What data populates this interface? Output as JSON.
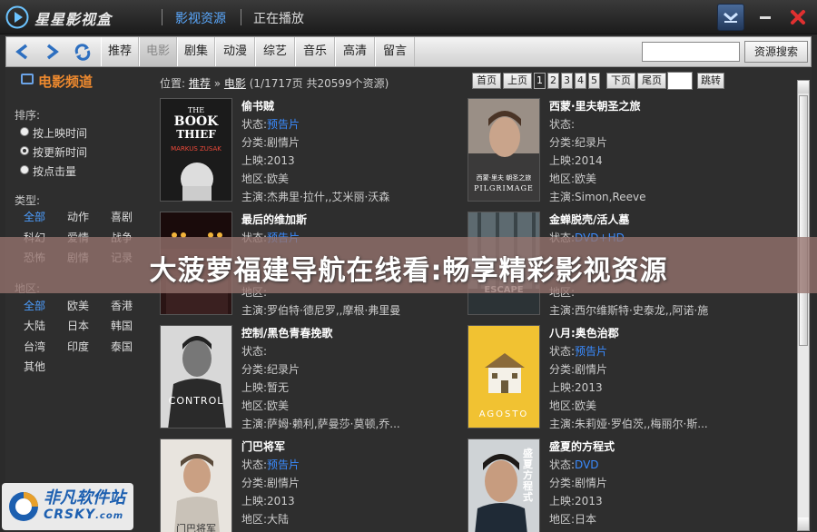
{
  "app": {
    "title": "星星影视盒"
  },
  "top_tabs": [
    {
      "label": "影视资源",
      "active": true
    },
    {
      "label": "正在播放",
      "active": false
    }
  ],
  "nav": {
    "tabs": [
      {
        "label": "推荐",
        "active": false
      },
      {
        "label": "电影",
        "active": true
      },
      {
        "label": "剧集",
        "active": false
      },
      {
        "label": "动漫",
        "active": false
      },
      {
        "label": "综艺",
        "active": false
      },
      {
        "label": "音乐",
        "active": false
      },
      {
        "label": "高清",
        "active": false
      },
      {
        "label": "留言",
        "active": false
      }
    ],
    "search_value": "",
    "search_button": "资源搜索"
  },
  "sidebar": {
    "channel_title": "电影频道",
    "sort_heading": "排序:",
    "sort_options": [
      {
        "label": "按上映时间",
        "selected": false
      },
      {
        "label": "按更新时间",
        "selected": true
      },
      {
        "label": "按点击量",
        "selected": false
      }
    ],
    "type_heading": "类型:",
    "types": [
      "全部",
      "动作",
      "喜剧",
      "科幻",
      "爱情",
      "战争",
      "恐怖",
      "剧情",
      "记录"
    ],
    "region_heading": "地区:",
    "regions": [
      "全部",
      "欧美",
      "香港",
      "大陆",
      "日本",
      "韩国",
      "台湾",
      "印度",
      "泰国",
      "其他"
    ]
  },
  "breadcrumb": {
    "prefix": "位置:",
    "home": "推荐",
    "sep": "»",
    "current": "电影",
    "info": "(1/1717页 共20599个资源)"
  },
  "pager": {
    "first": "首页",
    "prev": "上页",
    "pages": [
      "1",
      "2",
      "3",
      "4",
      "5"
    ],
    "current": "1",
    "next": "下页",
    "last": "尾页",
    "jump": "跳转"
  },
  "field_labels": {
    "status": "状态:",
    "category": "分类:",
    "release": "上映:",
    "region": "地区:",
    "cast": "主演:"
  },
  "movies": [
    {
      "title": "偷书贼",
      "status": "预告片",
      "category": "剧情片",
      "release": "2013",
      "region": "欧美",
      "cast": "杰弗里·拉什,,艾米丽·沃森",
      "poster_lines": [
        "THE",
        "BOOK",
        "THIEF",
        "MARKUS ZUSAK"
      ]
    },
    {
      "title": "西蒙·里夫朝圣之旅",
      "status": "",
      "category": "纪录片",
      "release": "2014",
      "region": "欧美",
      "cast": "Simon,Reeve",
      "poster_lines": [
        "西蒙·里夫 朝圣之旅",
        "PILGRIMAGE"
      ]
    },
    {
      "title": "最后的维加斯",
      "status": "预告片",
      "category": "",
      "release": "",
      "region": "",
      "cast": "罗伯特·德尼罗,,摩根·弗里曼",
      "poster_lines": []
    },
    {
      "title": "金蝉脱壳/活人墓",
      "status": "DVD+HD",
      "category": "",
      "release": "",
      "region": "",
      "cast": "西尔维斯特·史泰龙,,阿诺·施",
      "poster_lines": [
        "ESCAPE"
      ]
    },
    {
      "title": "控制/黑色青春挽歌",
      "status": "",
      "category": "纪录片",
      "release": "暂无",
      "region": "欧美",
      "cast": "萨姆·赖利,萨曼莎·莫顿,乔...",
      "poster_lines": [
        "CONTROL"
      ]
    },
    {
      "title": "八月:奥色治郡",
      "status": "预告片",
      "category": "剧情片",
      "release": "2013",
      "region": "欧美",
      "cast": "朱莉娅·罗伯茨,,梅丽尔·斯...",
      "poster_lines": [
        "AGOSTO"
      ]
    },
    {
      "title": "门巴将军",
      "status": "预告片",
      "category": "剧情片",
      "release": "2013",
      "region": "大陆",
      "cast": "",
      "poster_lines": [
        "门巴将军"
      ]
    },
    {
      "title": "盛夏的方程式",
      "status": "DVD",
      "category": "剧情片",
      "release": "2013",
      "region": "日本",
      "cast": "",
      "poster_lines": [
        "盛夏方程式"
      ]
    }
  ],
  "banner": {
    "text": "大菠萝福建导航在线看:畅享精彩影视资源"
  },
  "watermark": {
    "name": "非凡软件站",
    "url": "CRSKY",
    "domain": ".com"
  },
  "colors": {
    "accent_blue": "#3a8bff",
    "channel_orange": "#ef8a2e",
    "close_red": "#e03030"
  }
}
